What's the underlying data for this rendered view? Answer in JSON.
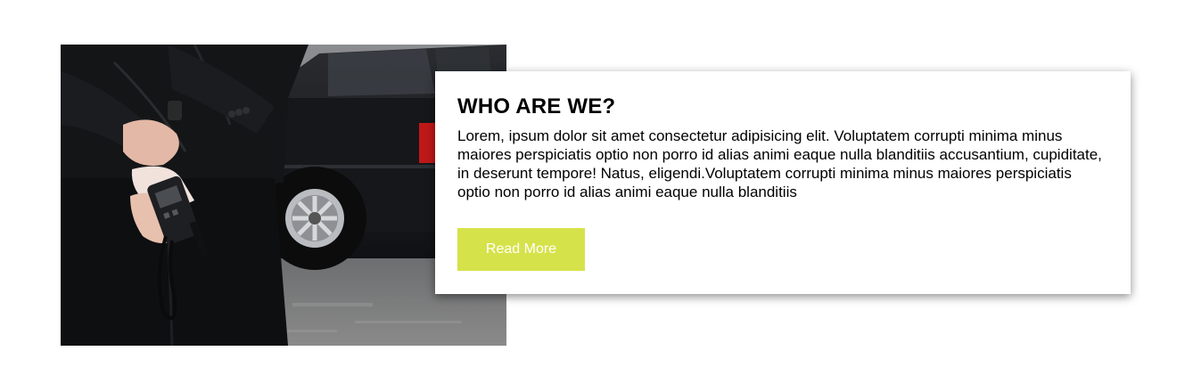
{
  "section": {
    "image_alt": "Security guard holding a walkie-talkie behind their back next to a black car",
    "title": "WHO ARE WE?",
    "body": "Lorem, ipsum dolor sit amet consectetur adipisicing elit. Voluptatem corrupti minima minus maiores perspiciatis optio non porro id alias animi eaque nulla blanditiis accusantium, cupiditate, in deserunt tempore! Natus, eligendi.Voluptatem corrupti minima minus maiores perspiciatis optio non porro id alias animi eaque nulla blanditiis",
    "button_label": "Read More"
  },
  "colors": {
    "accent": "#d6e24a",
    "button_text": "#ffffff",
    "card_bg": "#ffffff",
    "text": "#000000"
  }
}
